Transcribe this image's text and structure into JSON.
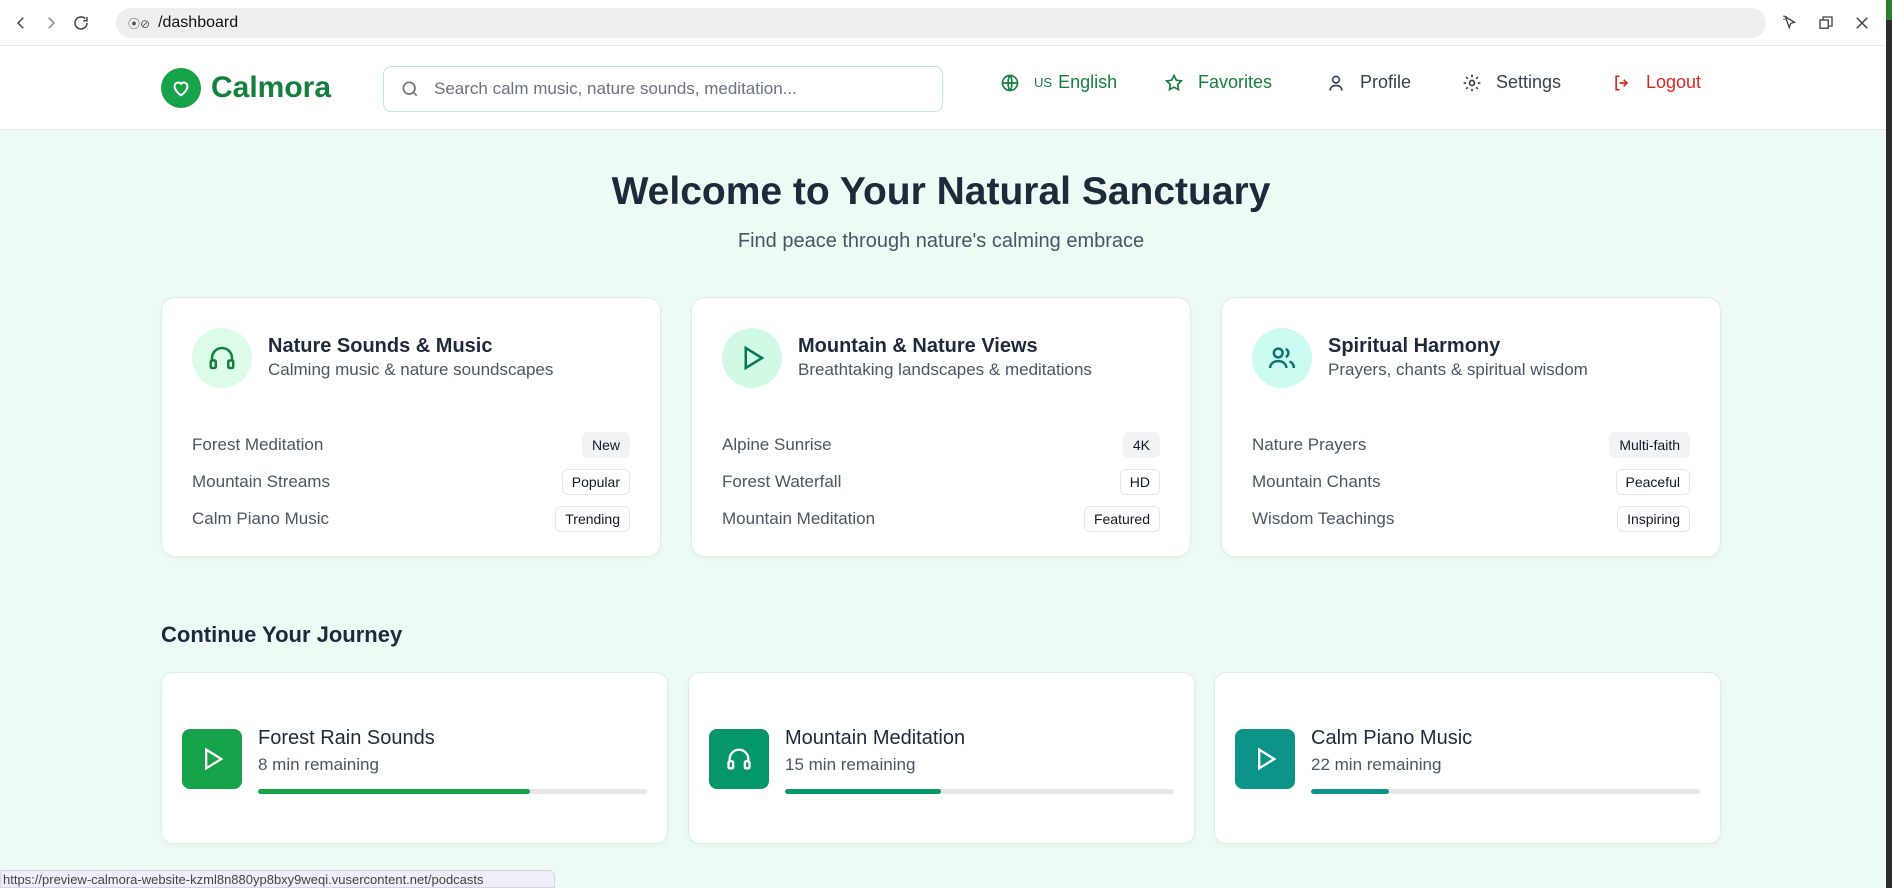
{
  "browser": {
    "url": "/dashboard",
    "status_url": "https://preview-calmora-website-kzml8n880yp8bxy9weqi.vusercontent.net/podcasts"
  },
  "header": {
    "brand": "Calmora",
    "search_placeholder": "Search calm music, nature sounds, meditation...",
    "language_flag": "US",
    "language": "English",
    "favorites": "Favorites",
    "profile": "Profile",
    "settings": "Settings",
    "logout": "Logout"
  },
  "hero": {
    "title": "Welcome to Your Natural Sanctuary",
    "subtitle": "Find peace through nature's calming embrace"
  },
  "categories": [
    {
      "title": "Nature Sounds & Music",
      "description": "Calming music & nature soundscapes",
      "icon": "headphones-icon",
      "items": [
        {
          "label": "Forest Meditation",
          "badge": "New"
        },
        {
          "label": "Mountain Streams",
          "badge": "Popular"
        },
        {
          "label": "Calm Piano Music",
          "badge": "Trending"
        }
      ]
    },
    {
      "title": "Mountain & Nature Views",
      "description": "Breathtaking landscapes & meditations",
      "icon": "play-icon",
      "items": [
        {
          "label": "Alpine Sunrise",
          "badge": "4K"
        },
        {
          "label": "Forest Waterfall",
          "badge": "HD"
        },
        {
          "label": "Mountain Meditation",
          "badge": "Featured"
        }
      ]
    },
    {
      "title": "Spiritual Harmony",
      "description": "Prayers, chants & spiritual wisdom",
      "icon": "users-icon",
      "items": [
        {
          "label": "Nature Prayers",
          "badge": "Multi-faith"
        },
        {
          "label": "Mountain Chants",
          "badge": "Peaceful"
        },
        {
          "label": "Wisdom Teachings",
          "badge": "Inspiring"
        }
      ]
    }
  ],
  "continue": {
    "title": "Continue Your Journey",
    "items": [
      {
        "title": "Forest Rain Sounds",
        "remaining": "8 min remaining",
        "progress": 0.7,
        "icon": "play-icon",
        "color": "#16a34a"
      },
      {
        "title": "Mountain Meditation",
        "remaining": "15 min remaining",
        "progress": 0.4,
        "icon": "headphones-icon",
        "color": "#059669"
      },
      {
        "title": "Calm Piano Music",
        "remaining": "22 min remaining",
        "progress": 0.2,
        "icon": "play-icon",
        "color": "#0d9488"
      }
    ]
  },
  "colors": {
    "brand": "#16a34a",
    "brand_text": "#15803d",
    "logout": "#dc2626",
    "page_bg": "#eefbf4"
  }
}
